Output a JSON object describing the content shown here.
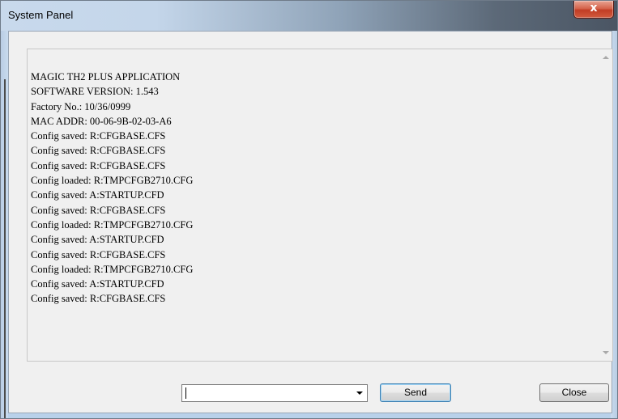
{
  "window": {
    "title": "System Panel",
    "close_glyph": "x"
  },
  "log": {
    "lines": [
      "MAGIC TH2 PLUS APPLICATION",
      "SOFTWARE VERSION: 1.543",
      "Factory No.: 10/36/0999",
      "MAC ADDR: 00-06-9B-02-03-A6",
      "Config saved: R:CFGBASE.CFS",
      "Config saved: R:CFGBASE.CFS",
      "Config saved: R:CFGBASE.CFS",
      "Config loaded: R:TMPCFGB2710.CFG",
      "Config saved: A:STARTUP.CFD",
      "Config saved: R:CFGBASE.CFS",
      "Config loaded: R:TMPCFGB2710.CFG",
      "Config saved: A:STARTUP.CFD",
      "Config saved: R:CFGBASE.CFS",
      "Config loaded: R:TMPCFGB2710.CFG",
      "Config saved: A:STARTUP.CFD",
      "Config saved: R:CFGBASE.CFS"
    ]
  },
  "command": {
    "value": ""
  },
  "buttons": {
    "send_label": "Send",
    "close_label": "Close"
  },
  "icons": {
    "scroll_up": "chevron-up-icon",
    "scroll_down": "chevron-down-icon",
    "dropdown": "chevron-down-icon",
    "window_close": "close-icon"
  }
}
